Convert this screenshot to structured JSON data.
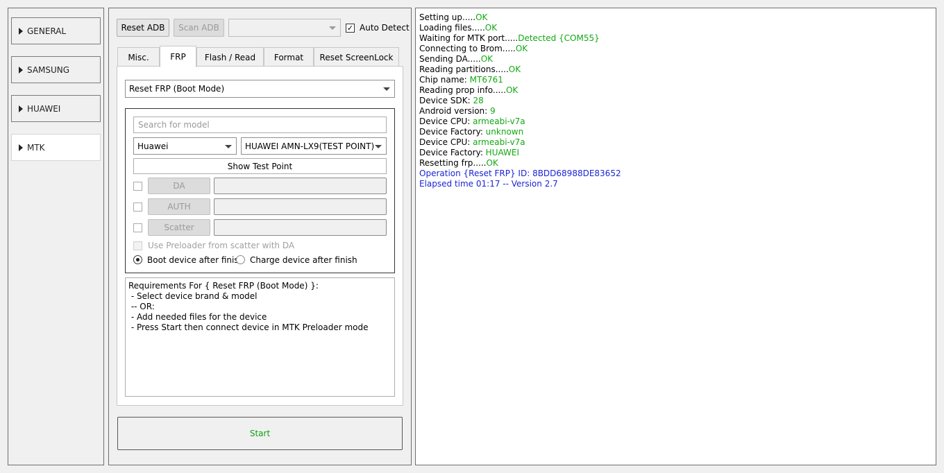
{
  "sidebar": {
    "items": [
      {
        "label": "GENERAL",
        "active": false
      },
      {
        "label": "SAMSUNG",
        "active": false
      },
      {
        "label": "HUAWEI",
        "active": false
      },
      {
        "label": "MTK",
        "active": true
      }
    ]
  },
  "toolbar": {
    "reset_adb": "Reset ADB",
    "scan_adb": "Scan ADB",
    "port_select_value": "",
    "auto_detect_label": "Auto Detect",
    "auto_detect_checked": true
  },
  "tabs": [
    "Misc.",
    "FRP",
    "Flash / Read",
    "Format",
    "Reset ScreenLock"
  ],
  "active_tab": "FRP",
  "frp": {
    "operation_value": "Reset FRP (Boot Mode)",
    "search_placeholder": "Search for model",
    "brand_value": "Huawei",
    "model_value": "HUAWEI AMN-LX9(TEST POINT)",
    "show_test_point": "Show Test Point",
    "files": [
      {
        "label": "DA",
        "value": ""
      },
      {
        "label": "AUTH",
        "value": ""
      },
      {
        "label": "Scatter",
        "value": ""
      }
    ],
    "use_preloader_label": "Use Preloader from scatter with DA",
    "boot_after_label": "Boot device after finish",
    "charge_after_label": "Charge device after finish",
    "requirements": [
      "Requirements For { Reset FRP (Boot Mode) }:",
      " - Select device brand & model",
      " -- OR:",
      " - Add needed files for the device",
      " - Press Start then connect device in MTK Preloader mode"
    ]
  },
  "start_label": "Start",
  "colors": {
    "ok": "#13a813",
    "info": "#1a24d6"
  },
  "log": [
    {
      "label": "Setting up.....",
      "value": "OK",
      "style": "ok"
    },
    {
      "label": "Loading files.....",
      "value": "OK",
      "style": "ok"
    },
    {
      "label": "Waiting for MTK port.....",
      "value": "Detected {COM55}",
      "style": "ok"
    },
    {
      "label": "Connecting to Brom.....",
      "value": "OK",
      "style": "ok"
    },
    {
      "label": "Sending DA.....",
      "value": "OK",
      "style": "ok"
    },
    {
      "label": "Reading partitions.....",
      "value": "OK",
      "style": "ok"
    },
    {
      "label": "Chip name: ",
      "value": "MT6761",
      "style": "ok"
    },
    {
      "label": "Reading prop info.....",
      "value": "OK",
      "style": "ok"
    },
    {
      "label": "Device SDK: ",
      "value": "28",
      "style": "ok"
    },
    {
      "label": "Android version: ",
      "value": "9",
      "style": "ok"
    },
    {
      "label": "Device CPU: ",
      "value": "armeabi-v7a",
      "style": "ok"
    },
    {
      "label": "Device Factory: ",
      "value": "unknown",
      "style": "ok"
    },
    {
      "label": "Device CPU: ",
      "value": "armeabi-v7a",
      "style": "ok"
    },
    {
      "label": "Device Factory: ",
      "value": "HUAWEI",
      "style": "ok"
    },
    {
      "label": "Resetting frp.....",
      "value": "OK",
      "style": "ok"
    },
    {
      "label": "Operation {Reset FRP} ID: 8BDD68988DE83652",
      "value": "",
      "style": "blue"
    },
    {
      "label": "Elapsed time 01:17 -- Version 2.7",
      "value": "",
      "style": "blue"
    }
  ]
}
